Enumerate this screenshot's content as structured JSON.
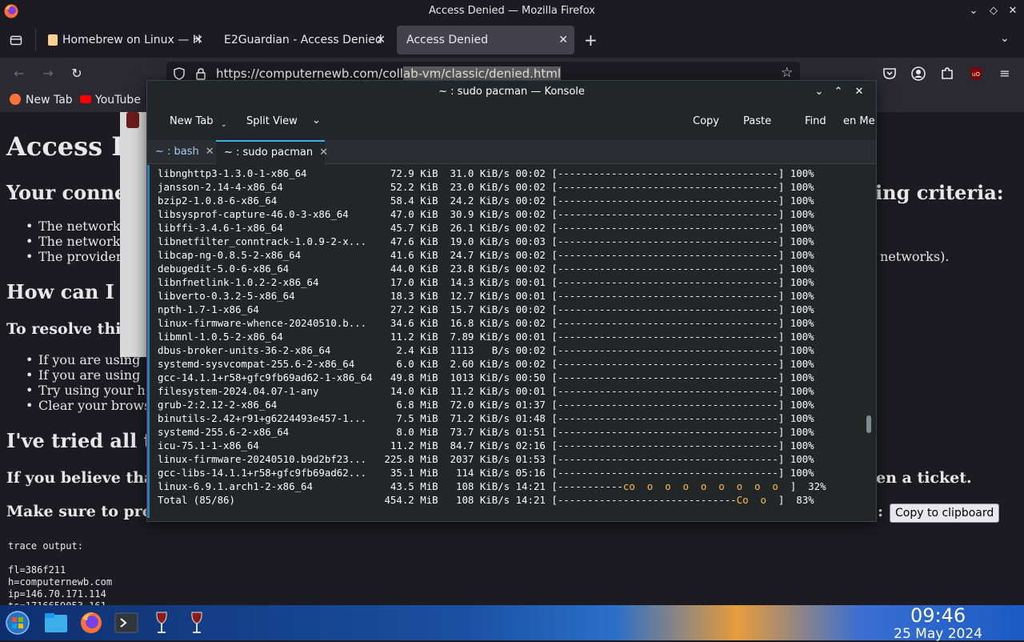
{
  "firefox": {
    "window_title": "Access Denied — Mozilla Firefox",
    "tabs": [
      {
        "label": "Homebrew on Linux — H",
        "active": false
      },
      {
        "label": "E2Guardian - Access Denied",
        "active": false
      },
      {
        "label": "Access Denied",
        "active": true
      }
    ],
    "url": {
      "prefix": "https://computernewb.com/coll",
      "selected": "ab-vm/classic/denied.html"
    },
    "bookmarks": [
      "New Tab",
      "YouTube"
    ]
  },
  "page": {
    "heading": "Access D",
    "section1": "Your conne",
    "section1_tail": "ing criteria:",
    "bullets1": [
      "The network",
      "The network",
      "The provider"
    ],
    "bullets1_tail": "networks).",
    "section2": "How can I",
    "bold1": "To resolve thi",
    "bullets2": [
      "If you are using",
      "If you are using",
      "Try using your h",
      "Clear your brows"
    ],
    "section3": "I've tried all t",
    "bold2": "If you believe tha",
    "bold2_tail": "en a ticket.",
    "bold3": "Make sure to pro",
    "bold3_tail": ":",
    "copy_button": "Copy to clipboard",
    "trace": [
      "trace output:",
      "",
      "fl=386f211",
      "h=computernewb.com",
      "ip=146.70.171.114",
      "ts=1716659053.161"
    ]
  },
  "konsole": {
    "title": "~ : sudo pacman — Konsole",
    "toolbar": {
      "new_tab": "New Tab",
      "split_view": "Split View",
      "copy": "Copy",
      "paste": "Paste",
      "find": "Find",
      "menu": "en Me"
    },
    "tabs": [
      {
        "label": "~ : bash",
        "active": false
      },
      {
        "label": "~ : sudo pacman",
        "active": true
      }
    ],
    "lines": [
      {
        "name": "libnghttp3-1.3.0-1-x86_64",
        "size": "72.9 KiB",
        "rate": "31.0 KiB/s",
        "eta": "00:02",
        "bar": "[-------------------------------------]",
        "pct": "100%"
      },
      {
        "name": "jansson-2.14-4-x86_64",
        "size": "52.2 KiB",
        "rate": "23.0 KiB/s",
        "eta": "00:02",
        "bar": "[-------------------------------------]",
        "pct": "100%"
      },
      {
        "name": "bzip2-1.0.8-6-x86_64",
        "size": "58.4 KiB",
        "rate": "24.2 KiB/s",
        "eta": "00:02",
        "bar": "[-------------------------------------]",
        "pct": "100%"
      },
      {
        "name": "libsysprof-capture-46.0-3-x86_64",
        "size": "47.0 KiB",
        "rate": "30.9 KiB/s",
        "eta": "00:02",
        "bar": "[-------------------------------------]",
        "pct": "100%"
      },
      {
        "name": "libffi-3.4.6-1-x86_64",
        "size": "45.7 KiB",
        "rate": "26.1 KiB/s",
        "eta": "00:02",
        "bar": "[-------------------------------------]",
        "pct": "100%"
      },
      {
        "name": "libnetfilter_conntrack-1.0.9-2-x...",
        "size": "47.6 KiB",
        "rate": "19.0 KiB/s",
        "eta": "00:03",
        "bar": "[-------------------------------------]",
        "pct": "100%"
      },
      {
        "name": "libcap-ng-0.8.5-2-x86_64",
        "size": "41.6 KiB",
        "rate": "24.7 KiB/s",
        "eta": "00:02",
        "bar": "[-------------------------------------]",
        "pct": "100%"
      },
      {
        "name": "debugedit-5.0-6-x86_64",
        "size": "44.0 KiB",
        "rate": "23.8 KiB/s",
        "eta": "00:02",
        "bar": "[-------------------------------------]",
        "pct": "100%"
      },
      {
        "name": "libnfnetlink-1.0.2-2-x86_64",
        "size": "17.0 KiB",
        "rate": "14.3 KiB/s",
        "eta": "00:01",
        "bar": "[-------------------------------------]",
        "pct": "100%"
      },
      {
        "name": "libverto-0.3.2-5-x86_64",
        "size": "18.3 KiB",
        "rate": "12.7 KiB/s",
        "eta": "00:01",
        "bar": "[-------------------------------------]",
        "pct": "100%"
      },
      {
        "name": "npth-1.7-1-x86_64",
        "size": "27.2 KiB",
        "rate": "15.7 KiB/s",
        "eta": "00:02",
        "bar": "[-------------------------------------]",
        "pct": "100%"
      },
      {
        "name": "linux-firmware-whence-20240510.b...",
        "size": "34.6 KiB",
        "rate": "16.8 KiB/s",
        "eta": "00:02",
        "bar": "[-------------------------------------]",
        "pct": "100%"
      },
      {
        "name": "libmnl-1.0.5-2-x86_64",
        "size": "11.2 KiB",
        "rate": "7.89 KiB/s",
        "eta": "00:01",
        "bar": "[-------------------------------------]",
        "pct": "100%"
      },
      {
        "name": "dbus-broker-units-36-2-x86_64",
        "size": "2.4 KiB",
        "rate": "1113   B/s",
        "eta": "00:02",
        "bar": "[-------------------------------------]",
        "pct": "100%"
      },
      {
        "name": "systemd-sysvcompat-255.6-2-x86_64",
        "size": "6.0 KiB",
        "rate": "2.60 KiB/s",
        "eta": "00:02",
        "bar": "[-------------------------------------]",
        "pct": "100%"
      },
      {
        "name": "gcc-14.1.1+r58+gfc9fb69ad62-1-x86_64",
        "size": "49.8 MiB",
        "rate": "1013 KiB/s",
        "eta": "00:50",
        "bar": "[-------------------------------------]",
        "pct": "100%"
      },
      {
        "name": "filesystem-2024.04.07-1-any",
        "size": "14.0 KiB",
        "rate": "11.2 KiB/s",
        "eta": "00:01",
        "bar": "[-------------------------------------]",
        "pct": "100%"
      },
      {
        "name": "grub-2:2.12-2-x86_64",
        "size": "6.8 MiB",
        "rate": "72.0 KiB/s",
        "eta": "01:37",
        "bar": "[-------------------------------------]",
        "pct": "100%"
      },
      {
        "name": "binutils-2.42+r91+g6224493e457-1...",
        "size": "7.5 MiB",
        "rate": "71.2 KiB/s",
        "eta": "01:48",
        "bar": "[-------------------------------------]",
        "pct": "100%"
      },
      {
        "name": "systemd-255.6-2-x86_64",
        "size": "8.0 MiB",
        "rate": "73.7 KiB/s",
        "eta": "01:51",
        "bar": "[-------------------------------------]",
        "pct": "100%"
      },
      {
        "name": "icu-75.1-1-x86_64",
        "size": "11.2 MiB",
        "rate": "84.7 KiB/s",
        "eta": "02:16",
        "bar": "[-------------------------------------]",
        "pct": "100%"
      },
      {
        "name": "linux-firmware-20240510.b9d2bf23...",
        "size": "225.8 MiB",
        "rate": "2037 KiB/s",
        "eta": "01:53",
        "bar": "[-------------------------------------]",
        "pct": "100%"
      },
      {
        "name": "gcc-libs-14.1.1+r58+gfc9fb69ad62...",
        "size": "35.1 MiB",
        "rate": "114 KiB/s",
        "eta": "05:16",
        "bar": "[-------------------------------------]",
        "pct": "100%"
      },
      {
        "name": "linux-6.9.1.arch1-2-x86_64",
        "size": "43.5 MiB",
        "rate": "108 KiB/s",
        "eta": "14:21",
        "bar_done": "[-----------",
        "bar_pac": "c",
        "bar_rest": "o  o  o  o  o  o  o  o  o  ]",
        "pct": "32%"
      },
      {
        "name": "Total (85/86)",
        "size": "454.2 MiB",
        "rate": "108 KiB/s",
        "eta": "14:21",
        "bar_done": "[------------------------------",
        "bar_pac": "C",
        "bar_rest": "o  o  ]",
        "pct": "83%"
      }
    ]
  },
  "taskbar": {
    "time": "09:46",
    "date": "25 May 2024"
  }
}
